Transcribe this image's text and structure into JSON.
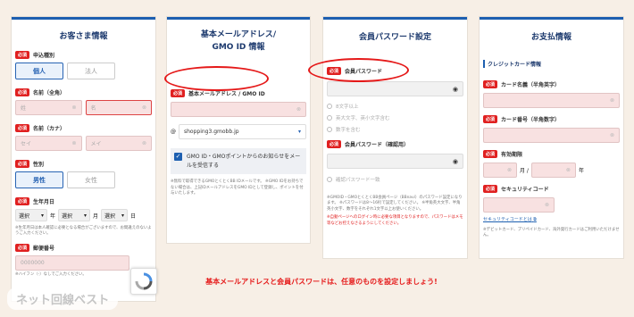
{
  "p1": {
    "title": "お客さま情報",
    "req": "必須",
    "gender_kind": "申込種別",
    "individual": "個人",
    "corporate": "法人",
    "name_kanji": "名前（全角）",
    "sei_ph": "姓",
    "mei_ph": "名",
    "name_kana": "名前（カナ）",
    "sei_kana_ph": "セイ",
    "mei_kana_ph": "メイ",
    "gender": "性別",
    "male": "男性",
    "female": "女性",
    "birthday": "生年月日",
    "select": "選択",
    "year": "年",
    "month": "月",
    "day": "日",
    "note": "※生年月日は本人確認に必要となる場合がございますので、お間違えのないようご入力ください。",
    "postal": "郵便番号",
    "postal_ph": "0000000",
    "postal_note": "※ハイフン（-）なしでご入力ください。"
  },
  "p2": {
    "title1": "基本メールアドレス/",
    "title2": "GMO ID 情報",
    "req": "必須",
    "mail_label": "基本メールアドレス / GMO ID",
    "at": "@",
    "domain": "shopping3.gmobb.jp",
    "check_text": "GMO ID・GMOポイントからのお知らせをメールを受信する",
    "note": "※無料で取得できるGMOとくとくBB IDメールです。 ※GMO IDをお持ちでない場合は、上記IDメールアドレスをGMO IDとして登録し、ポイントを付与いたします。"
  },
  "p3": {
    "title": "会員パスワード設定",
    "req": "必須",
    "pw_label": "会員パスワード",
    "rule1": "8文字以上",
    "rule2": "英大文字、英小文字含む",
    "rule3": "数字を含む",
    "pw2_label": "会員パスワード（確認用）",
    "match": "確認パスワード一致",
    "note": "※GMOID・GMOとくとくBB会員ページ（BBnavi）のパスワード設定になります。 ※パスワードは8〜16桁で設定してください。 ※半角英大文字、半角英小文字、数字をそれぞれ1文字以上お使いください。",
    "warn": "※自動ページへのログイン時に必要な項目となりますので、パスワードはメモ等などお控えなさるようにしてください。"
  },
  "p4": {
    "title": "お支払情報",
    "card_head": "クレジットカード情報",
    "req": "必須",
    "card_name": "カード名義（半角英字）",
    "card_number": "カード番号（半角数字）",
    "expiry": "有効期限",
    "month": "月 /",
    "year": "年",
    "security": "セキュリティコード",
    "security_link": "セキュリティコードとは",
    "note": "※デビットカード、プリペイドカード、海外発行カードはご利用いただけません。"
  },
  "caption": "基本メールアドレスと会員パスワードは、任意のものを設定しましょう!",
  "watermark": "ネット回線ベスト",
  "colors": {
    "accent": "#1d5fb0",
    "required": "#e02020",
    "highlight_oval": "#e51919",
    "caption": "#e51919"
  }
}
